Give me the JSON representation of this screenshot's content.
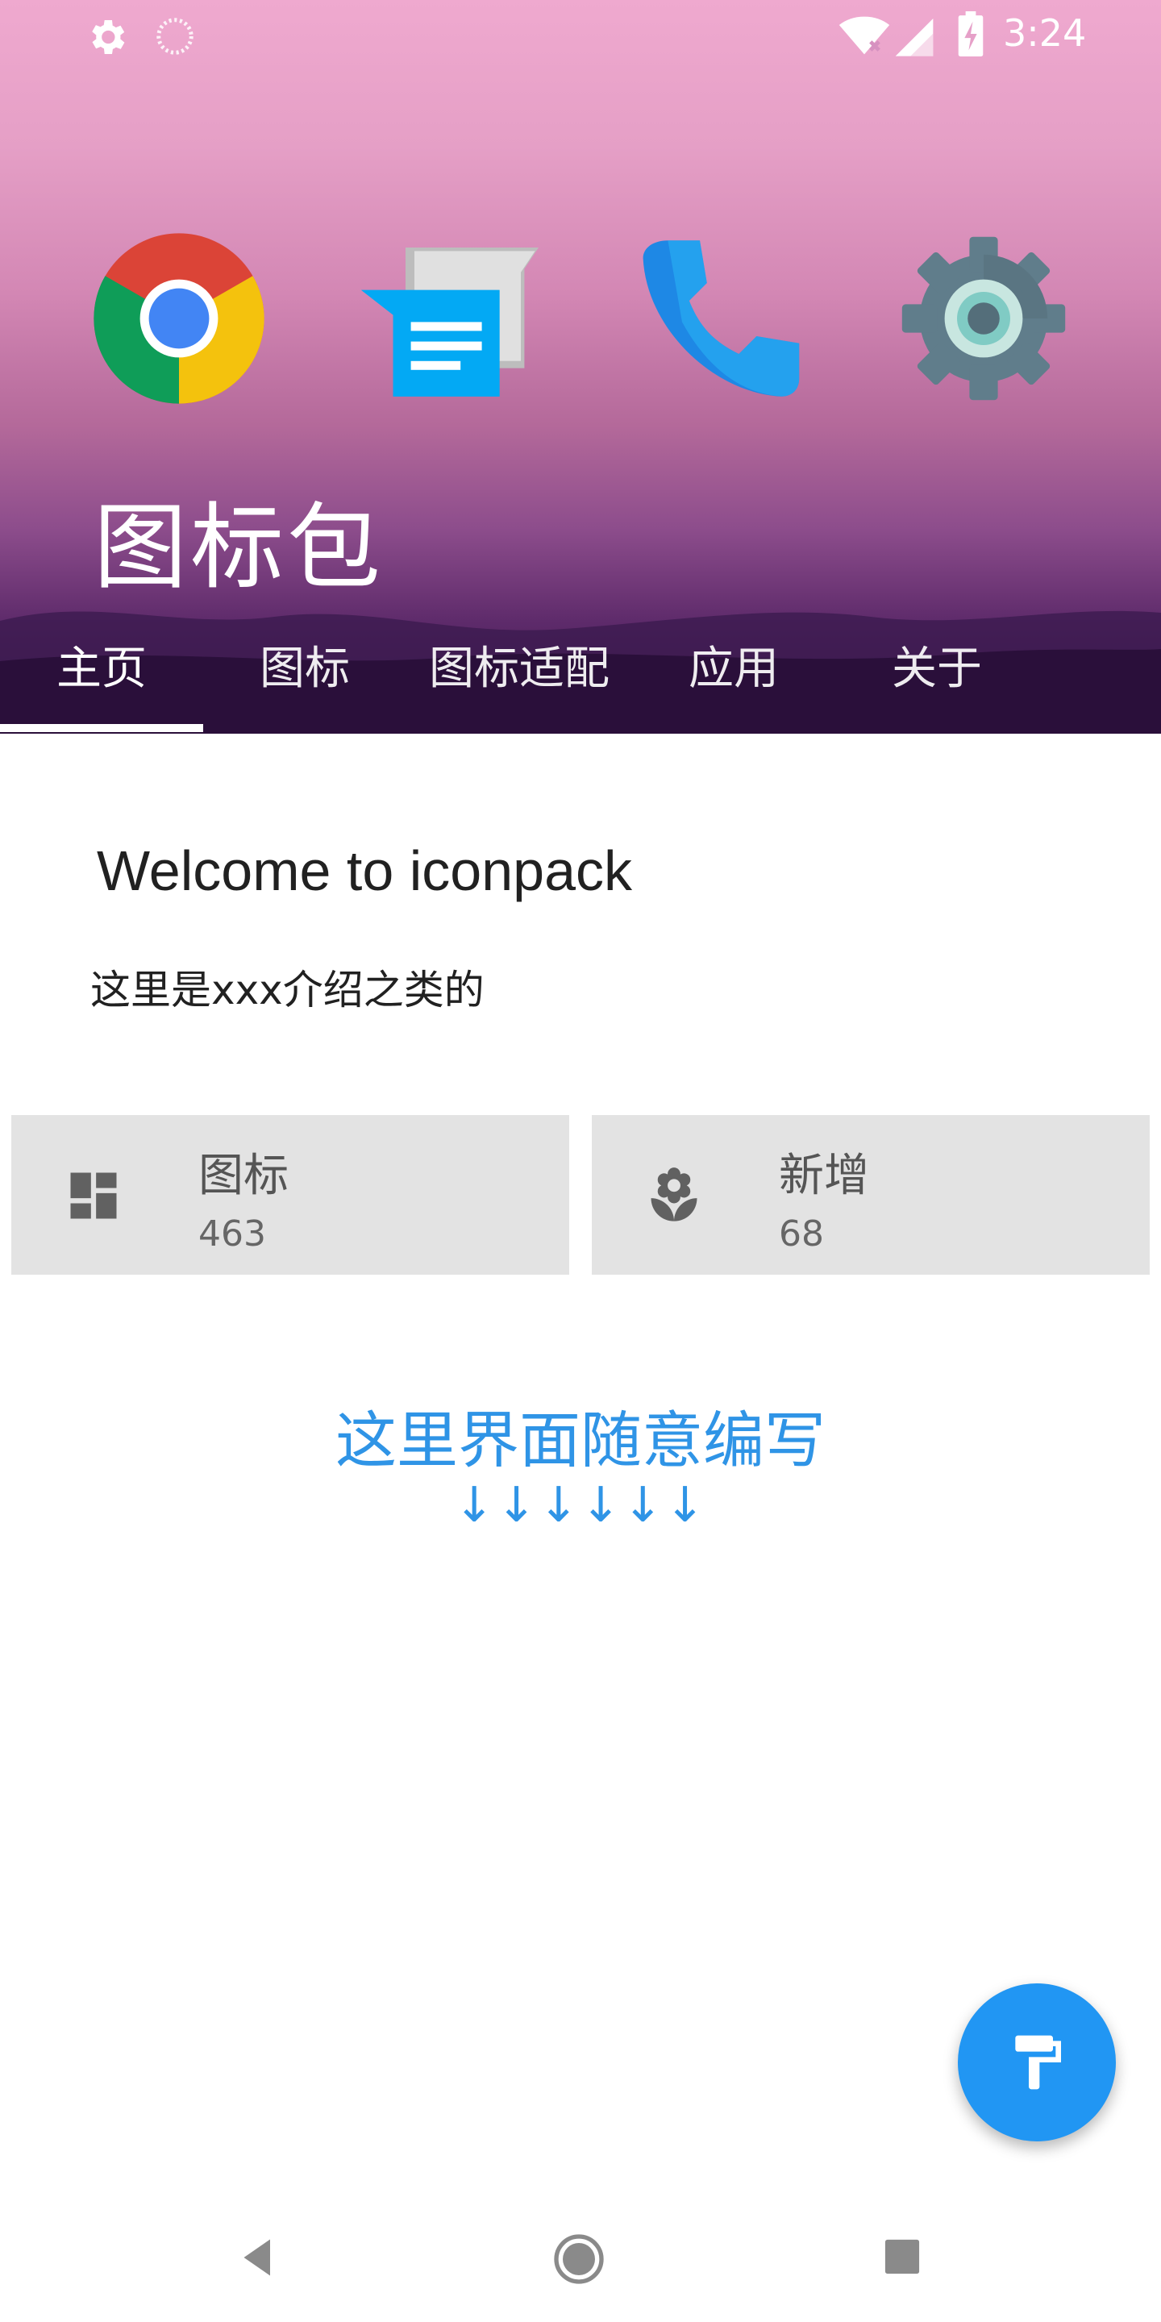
{
  "status_bar": {
    "time": "3:24",
    "icons": [
      "gear-icon",
      "spinner-icon",
      "wifi-icon",
      "signal-icon",
      "battery-charging-icon"
    ]
  },
  "header": {
    "title": "图标包",
    "app_icons": [
      "chrome-icon",
      "messages-icon",
      "phone-icon",
      "settings-icon"
    ],
    "colors": {
      "gradient_top": "#efa9cf",
      "gradient_bottom": "#3a1749"
    }
  },
  "tabs": [
    {
      "label": "主页",
      "active": true
    },
    {
      "label": "图标",
      "active": false
    },
    {
      "label": "图标适配",
      "active": false
    },
    {
      "label": "应用",
      "active": false
    },
    {
      "label": "关于",
      "active": false
    }
  ],
  "welcome": {
    "title": "Welcome to iconpack",
    "description": "这里是xxx介绍之类的"
  },
  "stats": [
    {
      "label": "图标",
      "value": "463",
      "icon": "dashboard-icon"
    },
    {
      "label": "新增",
      "value": "68",
      "icon": "flower-icon"
    }
  ],
  "edit_hint": {
    "text": "这里界面随意编写",
    "arrows": "↓↓↓↓↓↓"
  },
  "fab": {
    "icon": "paint-roller-icon",
    "color": "#2196f3"
  },
  "accent_color": "#2f94e6",
  "nav": [
    "back-icon",
    "home-icon",
    "recents-icon"
  ]
}
